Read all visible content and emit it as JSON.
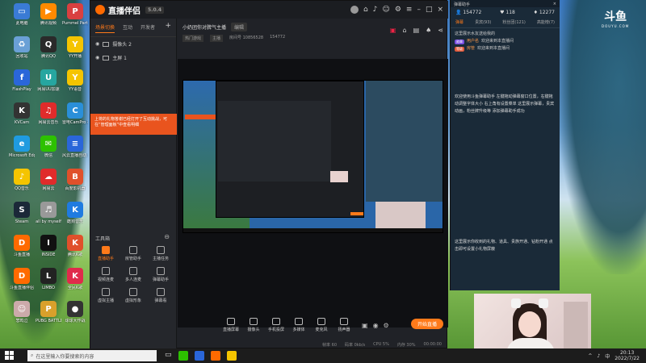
{
  "desktop_icons": [
    {
      "label": "此电脑",
      "color": "#3a7bd5",
      "glyph": "▭"
    },
    {
      "label": "腾讯视频",
      "color": "#ff8a00",
      "glyph": "▶"
    },
    {
      "label": "Pummel Party",
      "color": "#d94040",
      "glyph": "P"
    },
    {
      "label": "回收站",
      "color": "#6aa0d6",
      "glyph": "♻"
    },
    {
      "label": "腾讯QQ",
      "color": "#2a2a2a",
      "glyph": "Q"
    },
    {
      "label": "YY开播",
      "color": "#f5c400",
      "glyph": "Y"
    },
    {
      "label": "FlashPlay",
      "color": "#2a66d9",
      "glyph": "f"
    },
    {
      "label": "网易UU加速",
      "color": "#26a6a0",
      "glyph": "U"
    },
    {
      "label": "YY语音",
      "color": "#f5c400",
      "glyph": "Y"
    },
    {
      "label": "KVCam",
      "color": "#333",
      "glyph": "K"
    },
    {
      "label": "网易云音乐",
      "color": "#e02b2b",
      "glyph": "♫"
    },
    {
      "label": "雷电CamPro 机器",
      "color": "#2a8fd9",
      "glyph": "C"
    },
    {
      "label": "Microsoft Edge",
      "color": "#1f9be0",
      "glyph": "e"
    },
    {
      "label": "微信",
      "color": "#2dc100",
      "glyph": "✉"
    },
    {
      "label": "风云直播自动 大师",
      "color": "#2a66d9",
      "glyph": "≡"
    },
    {
      "label": "QQ音乐",
      "color": "#f5c400",
      "glyph": "♪"
    },
    {
      "label": "网易云",
      "color": "#e02b2b",
      "glyph": "☁"
    },
    {
      "label": "百度影机器",
      "color": "#e0502b",
      "glyph": "B"
    },
    {
      "label": "Steam",
      "color": "#1b2838",
      "glyph": "S"
    },
    {
      "label": "all by myself",
      "color": "#999",
      "glyph": "♬"
    },
    {
      "label": "酷狗音乐",
      "color": "#1f7be0",
      "glyph": "K"
    },
    {
      "label": "斗鱼直播",
      "color": "#ff6a00",
      "glyph": "D"
    },
    {
      "label": "INSIDE",
      "color": "#111",
      "glyph": "I"
    },
    {
      "label": "腾讯K歌",
      "color": "#e0502b",
      "glyph": "K"
    },
    {
      "label": "斗鱼直播伴侣",
      "color": "#ff6a00",
      "glyph": "D"
    },
    {
      "label": "LIMBO",
      "color": "#222",
      "glyph": "L"
    },
    {
      "label": "全民K歌",
      "color": "#e02b4b",
      "glyph": "K"
    },
    {
      "label": "悲鸣泣",
      "color": "#caa",
      "glyph": "☺"
    },
    {
      "label": "PUBG BATTLEGR",
      "color": "#d9a02b",
      "glyph": "P"
    },
    {
      "label": "球球大作战",
      "color": "#333",
      "glyph": "●"
    }
  ],
  "app": {
    "title": "直播伴侣",
    "version": "5.0.4",
    "tabs": [
      "场景切换",
      "互动",
      "开发者"
    ],
    "scenes": [
      "摄像头 2",
      "主屏 1"
    ],
    "notice": "上将的礼物答谢已经打开了互动挑战，可在“管理面板”中查看明细",
    "tools_title": "工具箱",
    "tools": [
      {
        "label": "直播助手",
        "hot": true
      },
      {
        "label": "房管助手",
        "hot": false
      },
      {
        "label": "主播任务",
        "hot": false
      },
      {
        "label": "视频连麦",
        "hot": false
      },
      {
        "label": "多人连麦",
        "hot": false
      },
      {
        "label": "弹幕助手",
        "hot": false
      },
      {
        "label": "虚拟主播",
        "hot": false
      },
      {
        "label": "虚拟形象",
        "hot": false
      },
      {
        "label": "弹幕看",
        "hot": false
      }
    ],
    "room_title": "小奶团你对脾气主播",
    "edit_label": "编辑",
    "room_tags": [
      "热门游戏",
      "主播"
    ],
    "room_no_label": "房间号 10856528",
    "room_fans": "154772",
    "controls": [
      "直播屏幕",
      "摄像头",
      "手机投屏",
      "多媒体",
      "麦克风",
      "扬声器"
    ],
    "live_button": "开始直播",
    "status": [
      "帧率 60",
      "码率 0kb/s",
      "CPU 5%",
      "内存 30%",
      "00:00:00"
    ]
  },
  "chat": {
    "header": "弹幕助手",
    "viewers": "154772",
    "gifts": "118",
    "fans": "12277",
    "tabs": [
      "弹幕",
      "贵宾(93)",
      "粉丝团(121)",
      "高能榜(7)"
    ],
    "messages": [
      {
        "text": "这里展示水友送给我的"
      },
      {
        "badge": "勋章",
        "user": "用户名",
        "text": "欢迎来到本直播间"
      },
      {
        "badge": "等级",
        "user": "房管",
        "text": "欢迎来到本直播间"
      }
    ],
    "info_1": "欢迎使用斗鱼弹幕助手 左键拖动弹幕窗口位置，右键拖动调整字体大小 右上角有设置菜单 这里展示弹幕，贵宾动画，粉丝牌升级等 添加弹幕助手成功",
    "info_2": "这里展示你收到的礼物、道具、贵族开通、钻粉开通 点击即可设置小礼物屏蔽"
  },
  "douyu": {
    "name": "斗鱼",
    "sub": "DOUYU.COM"
  },
  "taskbar": {
    "search_placeholder": "在这里输入你要搜索的内容",
    "lang": "中",
    "time": "20:13",
    "date": "2022/7/22"
  }
}
